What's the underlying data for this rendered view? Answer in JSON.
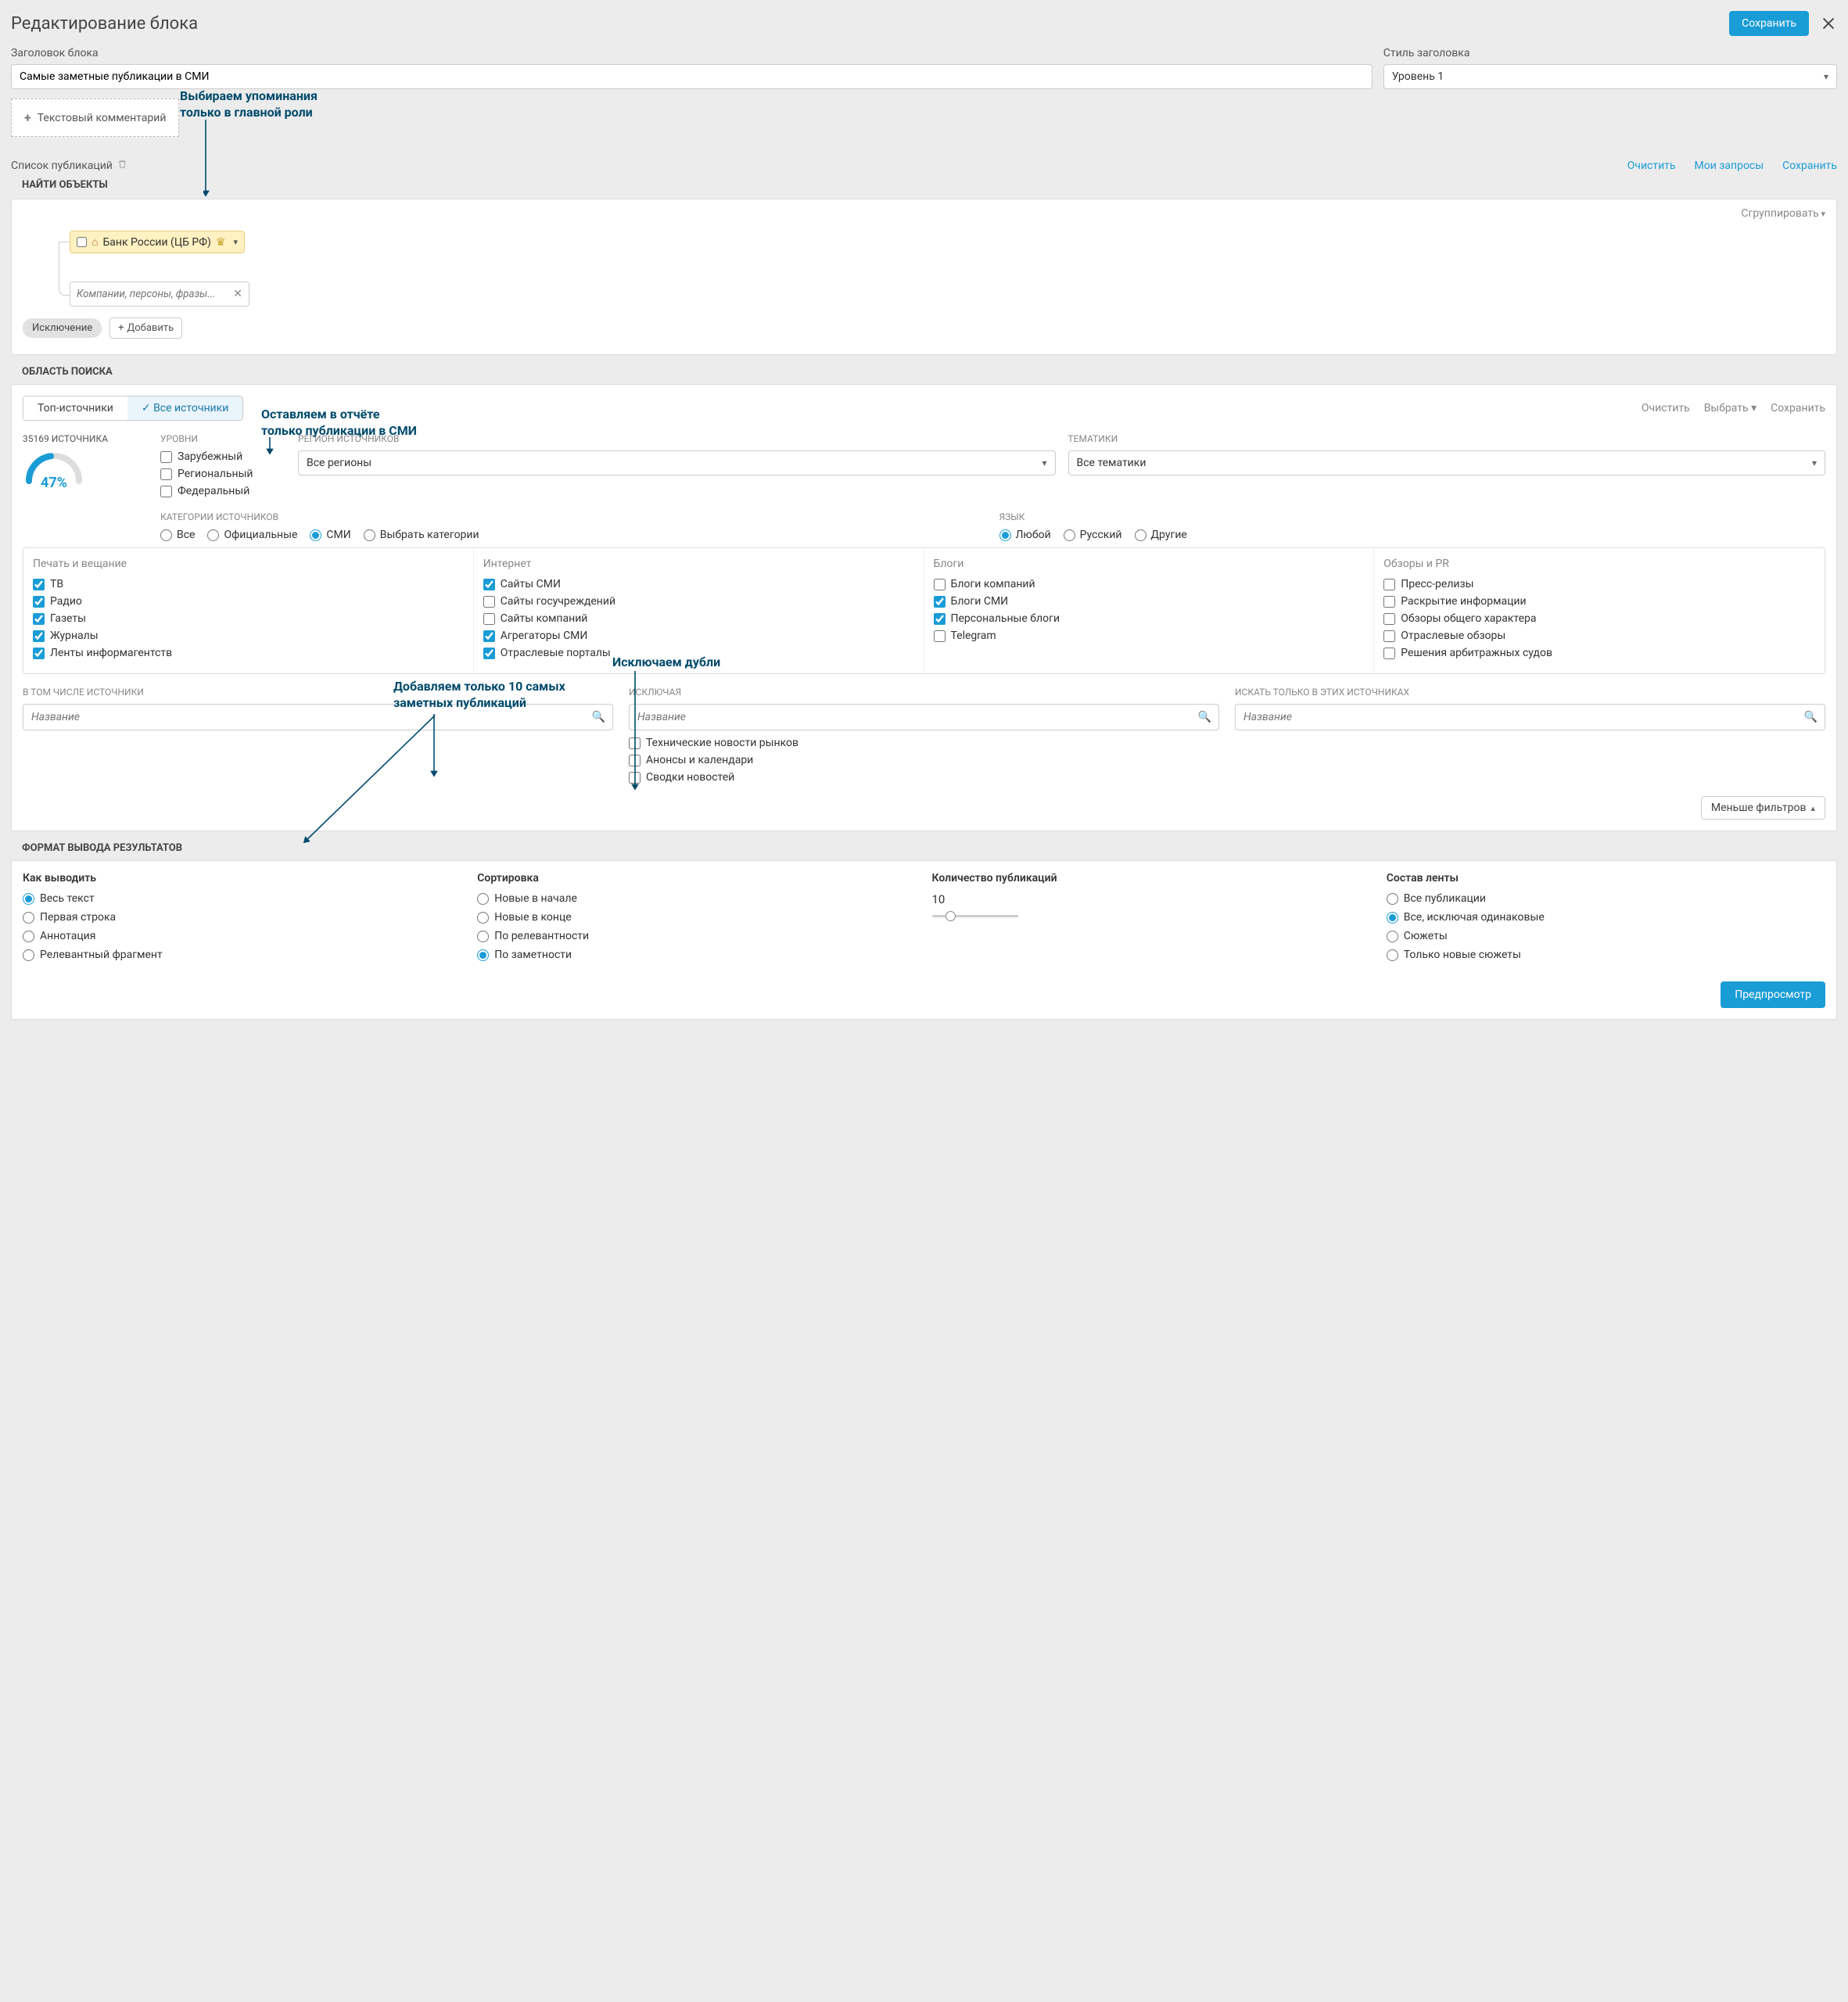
{
  "header": {
    "title": "Редактирование блока",
    "save": "Сохранить",
    "block_title_label": "Заголовок блока",
    "block_title_value": "Самые заметные публикации в СМИ",
    "style_label": "Стиль заголовка",
    "style_value": "Уровень 1",
    "comment_btn": "Текстовый комментарий",
    "note_a_l1": "Выбираем упоминания",
    "note_a_l2": "только в главной роли"
  },
  "pub_list": {
    "title": "Список публикаций",
    "clear": "Очистить",
    "my_queries": "Мои запросы",
    "save": "Сохранить"
  },
  "find": {
    "heading": "НАЙТИ ОБЪЕКТЫ",
    "group": "Сгруппировать",
    "tag_name": "Банк России (ЦБ РФ)",
    "search_placeholder": "Компании, персоны, фразы...",
    "exclusion": "Исключение",
    "add": "Добавить"
  },
  "search_area": {
    "heading": "ОБЛАСТЬ ПОИСКА",
    "tab_top": "Топ-источники",
    "tab_all": "Все источники",
    "clear": "Очистить",
    "choose": "Выбрать",
    "save": "Сохранить",
    "sources_count": "35169 ИСТОЧНИКА",
    "pct": "47%",
    "levels_label": "УРОВНИ",
    "lvl1": "Зарубежный",
    "lvl2": "Региональный",
    "lvl3": "Федеральный",
    "region_label": "РЕГИОН ИСТОЧНИКОВ",
    "region_value": "Все регионы",
    "topics_label": "ТЕМАТИКИ",
    "topics_value": "Все тематики",
    "lang_label": "ЯЗЫК",
    "lang1": "Любой",
    "lang2": "Русский",
    "lang3": "Другие",
    "cat_label": "КАТЕГОРИИ ИСТОЧНИКОВ",
    "cat_all": "Все",
    "cat_off": "Официальные",
    "cat_smi": "СМИ",
    "cat_choose": "Выбрать категории",
    "note_b_l1": "Оставляем в отчёте",
    "note_b_l2": "только публикации в СМИ",
    "note_c_l1": "Добавляем только 10 самых",
    "note_c_l2": "заметных публикаций",
    "note_d": "Исключаем дубли",
    "grp1_title": "Печать и вещание",
    "grp1_1": "ТВ",
    "grp1_2": "Радио",
    "grp1_3": "Газеты",
    "grp1_4": "Журналы",
    "grp1_5": "Ленты информагентств",
    "grp2_title": "Интернет",
    "grp2_1": "Сайты СМИ",
    "grp2_2": "Сайты госучреждений",
    "grp2_3": "Сайты компаний",
    "grp2_4": "Агрегаторы СМИ",
    "grp2_5": "Отраслевые порталы",
    "grp3_title": "Блоги",
    "grp3_1": "Блоги компаний",
    "grp3_2": "Блоги СМИ",
    "grp3_3": "Персональные блоги",
    "grp3_4": "Telegram",
    "grp4_title": "Обзоры и PR",
    "grp4_1": "Пресс-релизы",
    "grp4_2": "Раскрытие информации",
    "grp4_3": "Обзоры общего характера",
    "grp4_4": "Отраслевые обзоры",
    "grp4_5": "Решения арбитражных судов",
    "incl_label": "В ТОМ ЧИСЛЕ ИСТОЧНИКИ",
    "excl_label": "ИСКЛЮЧАЯ",
    "only_label": "ИСКАТЬ ТОЛЬКО В ЭТИХ ИСТОЧНИКАХ",
    "src_placeholder": "Название",
    "ex1": "Технические новости рынков",
    "ex2": "Анонсы и календари",
    "ex3": "Сводки новостей",
    "less_filters": "Меньше фильтров"
  },
  "format": {
    "heading": "ФОРМАТ ВЫВОДА РЕЗУЛЬТАТОВ",
    "col1_head": "Как выводить",
    "c1_1": "Весь текст",
    "c1_2": "Первая строка",
    "c1_3": "Аннотация",
    "c1_4": "Релевантный фрагмент",
    "col2_head": "Сортировка",
    "c2_1": "Новые в начале",
    "c2_2": "Новые в конце",
    "c2_3": "По релевантности",
    "c2_4": "По заметности",
    "col3_head": "Количество публикаций",
    "count_val": "10",
    "col4_head": "Состав ленты",
    "c4_1": "Все публикации",
    "c4_2": "Все, исключая одинаковые",
    "c4_3": "Сюжеты",
    "c4_4": "Только новые сюжеты",
    "preview": "Предпросмотр"
  }
}
